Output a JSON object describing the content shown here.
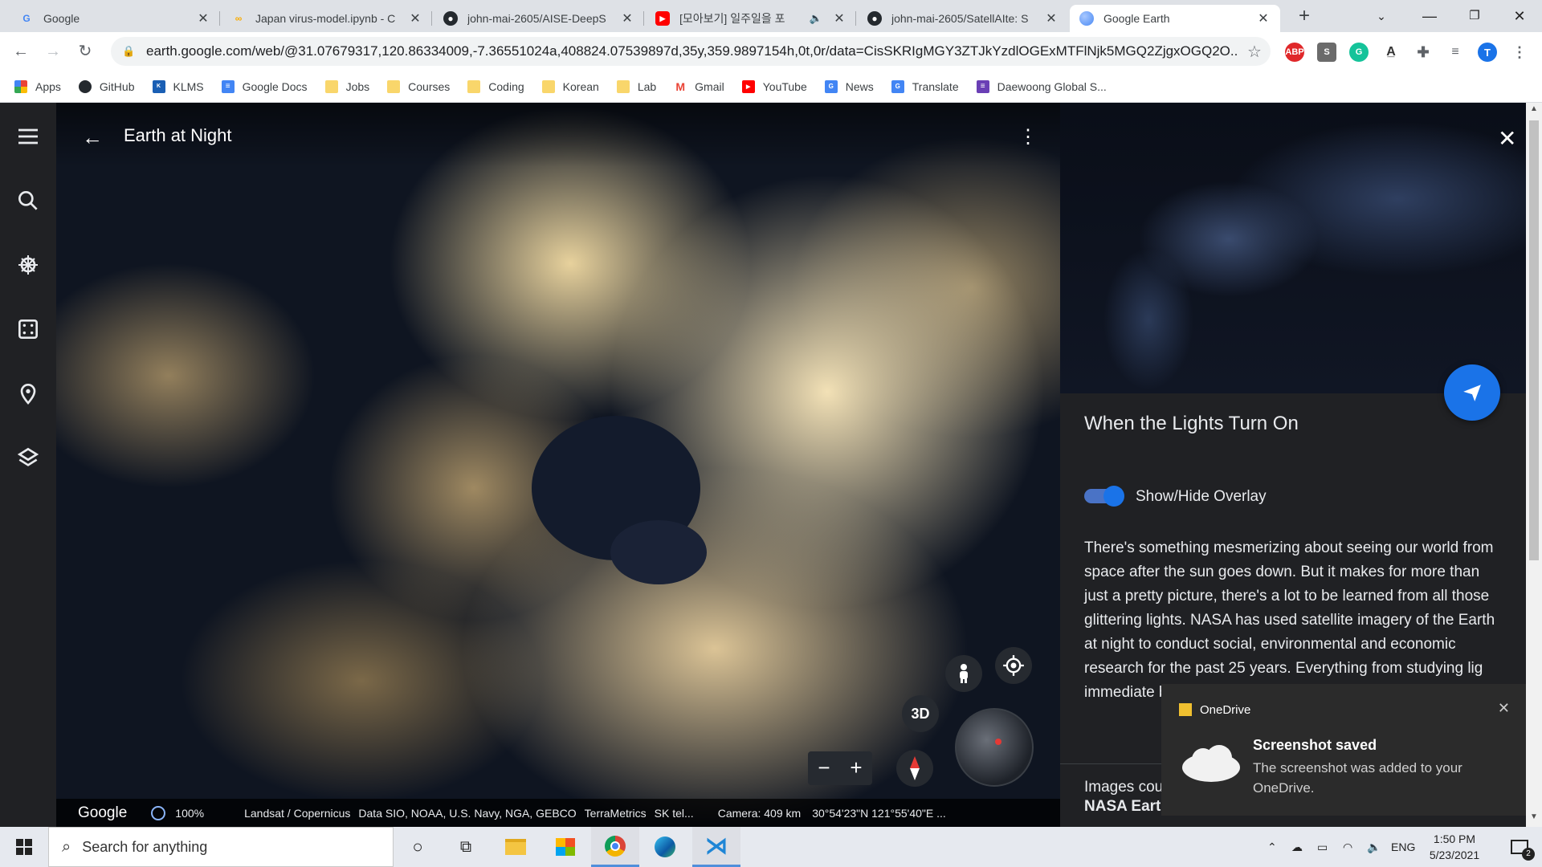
{
  "tabs": [
    {
      "title": "Google",
      "favicon": "google-icon",
      "color": "#4285f4"
    },
    {
      "title": "Japan virus-model.ipynb - C",
      "favicon": "colab-icon",
      "color": "#f9ab00"
    },
    {
      "title": "john-mai-2605/AISE-DeepS",
      "favicon": "github-icon",
      "color": "#24292e"
    },
    {
      "title": "[모아보기] 일주일을 포",
      "favicon": "youtube-icon",
      "color": "#ff0000"
    },
    {
      "title": "john-mai-2605/SatellAIte: S",
      "favicon": "github-icon",
      "color": "#24292e"
    },
    {
      "title": "Google Earth",
      "favicon": "google-earth-icon",
      "color": "#4a8af4"
    }
  ],
  "address": {
    "url": "earth.google.com/web/@31.07679317,120.86334009,-7.36551024a,408824.07539897d,35y,359.9897154h,0t,0r/data=CisSKRIgMGY3ZTJkYzdlOGExMTFlNjk5MGQ2ZjgxOGQ2O...",
    "profile_initial": "T"
  },
  "extensions": [
    "ABP",
    "S",
    "G"
  ],
  "bookmarks": [
    {
      "label": "Apps",
      "icon": "apps-grid-icon"
    },
    {
      "label": "GitHub",
      "icon": "github-icon"
    },
    {
      "label": "KLMS",
      "icon": "klms-icon"
    },
    {
      "label": "Google Docs",
      "icon": "google-docs-icon"
    },
    {
      "label": "Jobs",
      "icon": "folder-icon"
    },
    {
      "label": "Courses",
      "icon": "folder-icon"
    },
    {
      "label": "Coding",
      "icon": "folder-icon"
    },
    {
      "label": "Korean",
      "icon": "folder-icon"
    },
    {
      "label": "Lab",
      "icon": "folder-icon"
    },
    {
      "label": "Gmail",
      "icon": "gmail-icon"
    },
    {
      "label": "YouTube",
      "icon": "youtube-icon"
    },
    {
      "label": "News",
      "icon": "google-news-icon"
    },
    {
      "label": "Translate",
      "icon": "google-translate-icon"
    },
    {
      "label": "Daewoong Global S...",
      "icon": "daewoong-icon"
    }
  ],
  "earth": {
    "title": "Earth at Night",
    "map_controls": {
      "three_d_label": "3D"
    },
    "bottom": {
      "brand": "Google",
      "progress": "100%",
      "attribution": "Landsat / Copernicus",
      "data_sources": "Data SIO, NOAA, U.S. Navy, NGA, GEBCO",
      "terrametrics": "TerraMetrics",
      "sk": "SK tel...",
      "camera": "Camera: 409 km",
      "coords": "30°54'23\"N 121°55'40\"E ..."
    },
    "panel": {
      "heading": "When the Lights Turn On",
      "toggle_label": "Show/Hide Overlay",
      "toggle_on": true,
      "body": "There's something mesmerizing about seeing our world from space after the sun goes down. But it makes for more than just a pretty picture, there's a lot to be learned from all those glittering lights. NASA has used satellite imagery of the Earth at night to conduct social, environmental and economic research for the past 25 years. Everything from studying lig immediate be aided by",
      "credits_label": "Images cou",
      "credits_source": "NASA Eart"
    }
  },
  "toast": {
    "app": "OneDrive",
    "title": "Screenshot saved",
    "body": "The screenshot was added to your OneDrive."
  },
  "taskbar": {
    "search_placeholder": "Search for anything",
    "language": "ENG",
    "time": "1:50 PM",
    "date": "5/23/2021",
    "notification_count": "2"
  }
}
